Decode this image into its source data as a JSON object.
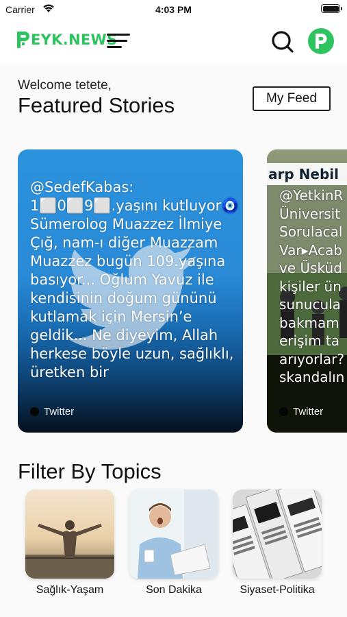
{
  "status_bar": {
    "carrier": "Carrier",
    "time": "4:03 PM"
  },
  "header": {
    "logo_text": "EYK.NEWS",
    "brand_color": "#2dc35f",
    "icons": [
      "menu-icon",
      "search-icon",
      "profile-avatar-icon"
    ]
  },
  "welcome": "Welcome tetete,",
  "featured_title": "Featured Stories",
  "my_feed_label": "My Feed",
  "stories": [
    {
      "text": "@SedefKabas:\n1⬜0⬜9⬜.yaşını kutluyor🧿\nSümerolog Muazzez İlmiye\nÇığ, nam-ı diğer Muazzam\nMuazzez bugün 109.yaşına\nbasıyor... Oğlum Yavuz ile\nkendisinin doğum gününü\nkutlamak için Mersin’e\ngeldik... Ne diyeyim, Allah\nherkese böyle uzun, sağlıklı,\nüretken bir",
      "source": "Twitter"
    },
    {
      "banner": "arp Nebil",
      "text": "@YetkinR\nÜniversit\nSorulacal\nVar▸Acab\nve Üsküd\nkişiler ün\nsunucula\nbakmam\nerişim ta\narıyorlar?\nskandalın",
      "source": "Twitter"
    }
  ],
  "filter_title": "Filter By Topics",
  "topics": [
    {
      "label": "Sağlık-Yaşam"
    },
    {
      "label": "Son Dakika"
    },
    {
      "label": "Siyaset-Politika"
    }
  ]
}
